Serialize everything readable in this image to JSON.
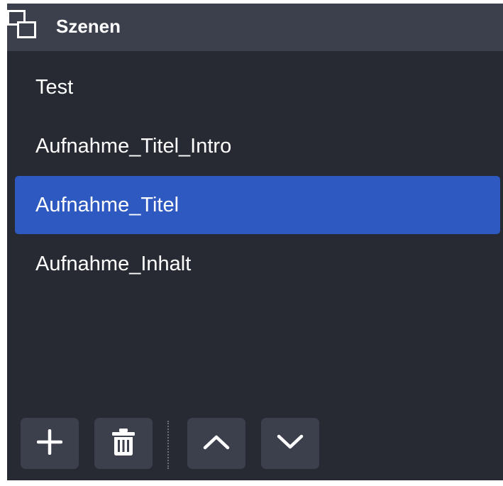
{
  "dock": {
    "title": "Szenen",
    "icon": "scenes-icon"
  },
  "scenes": [
    {
      "label": "Test",
      "selected": false
    },
    {
      "label": "Aufnahme_Titel_Intro",
      "selected": false
    },
    {
      "label": "Aufnahme_Titel",
      "selected": true
    },
    {
      "label": "Aufnahme_Inhalt",
      "selected": false
    }
  ],
  "toolbar": {
    "buttons": [
      {
        "name": "add-scene-button",
        "icon": "plus-icon"
      },
      {
        "name": "remove-scene-button",
        "icon": "trash-icon"
      },
      {
        "name": "move-scene-up-button",
        "icon": "chevron-up-icon"
      },
      {
        "name": "move-scene-down-button",
        "icon": "chevron-down-icon"
      }
    ]
  },
  "colors": {
    "dock_background": "#272a33",
    "header_background": "#3c404d",
    "selection": "#2e59c0",
    "button_background": "#3c404d",
    "text": "#ffffff"
  }
}
